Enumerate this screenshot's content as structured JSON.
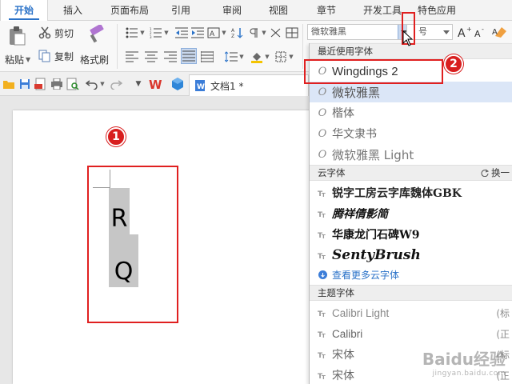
{
  "tabs": [
    "开始",
    "插入",
    "页面布局",
    "引用",
    "审阅",
    "视图",
    "章节",
    "开发工具",
    "特色应用"
  ],
  "ribbon": {
    "cut": "剪切",
    "paste": "粘贴",
    "copy": "复制",
    "format_painter": "格式刷",
    "font_name": "微软雅黑",
    "font_size": "号"
  },
  "document": {
    "tab_title": "文档1 *",
    "glyphs": [
      "R",
      "Q"
    ]
  },
  "font_panel": {
    "recent_header": "最近使用字体",
    "recent": [
      {
        "name": "Wingdings 2",
        "selected": false
      },
      {
        "name": "微软雅黑",
        "selected": true
      },
      {
        "name": "楷体",
        "selected": false
      },
      {
        "name": "华文隶书",
        "selected": false
      },
      {
        "name": "微软雅黑 Light",
        "selected": false
      }
    ],
    "cloud_header": "云字体",
    "cloud_action": "换一",
    "cloud": [
      "锐字工房云字库魏体GBK",
      "腾祥倩影简",
      "华康龙门石碑W9",
      "SentyBrush"
    ],
    "cloud_more": "查看更多云字体",
    "theme_header": "主题字体",
    "theme": [
      {
        "name": "Calibri Light",
        "note": "(标"
      },
      {
        "name": "Calibri",
        "note": "(正"
      },
      {
        "name": "宋体",
        "note": "(标"
      },
      {
        "name": "宋体",
        "note": "(正"
      }
    ]
  },
  "badges": [
    "1",
    "2"
  ],
  "watermark": {
    "main": "Baidu经验",
    "sub": "jingyan.baidu.com"
  },
  "colors": {
    "accent": "#2a72c8",
    "highlight": "#e02020",
    "selection": "#dbe6f7"
  }
}
